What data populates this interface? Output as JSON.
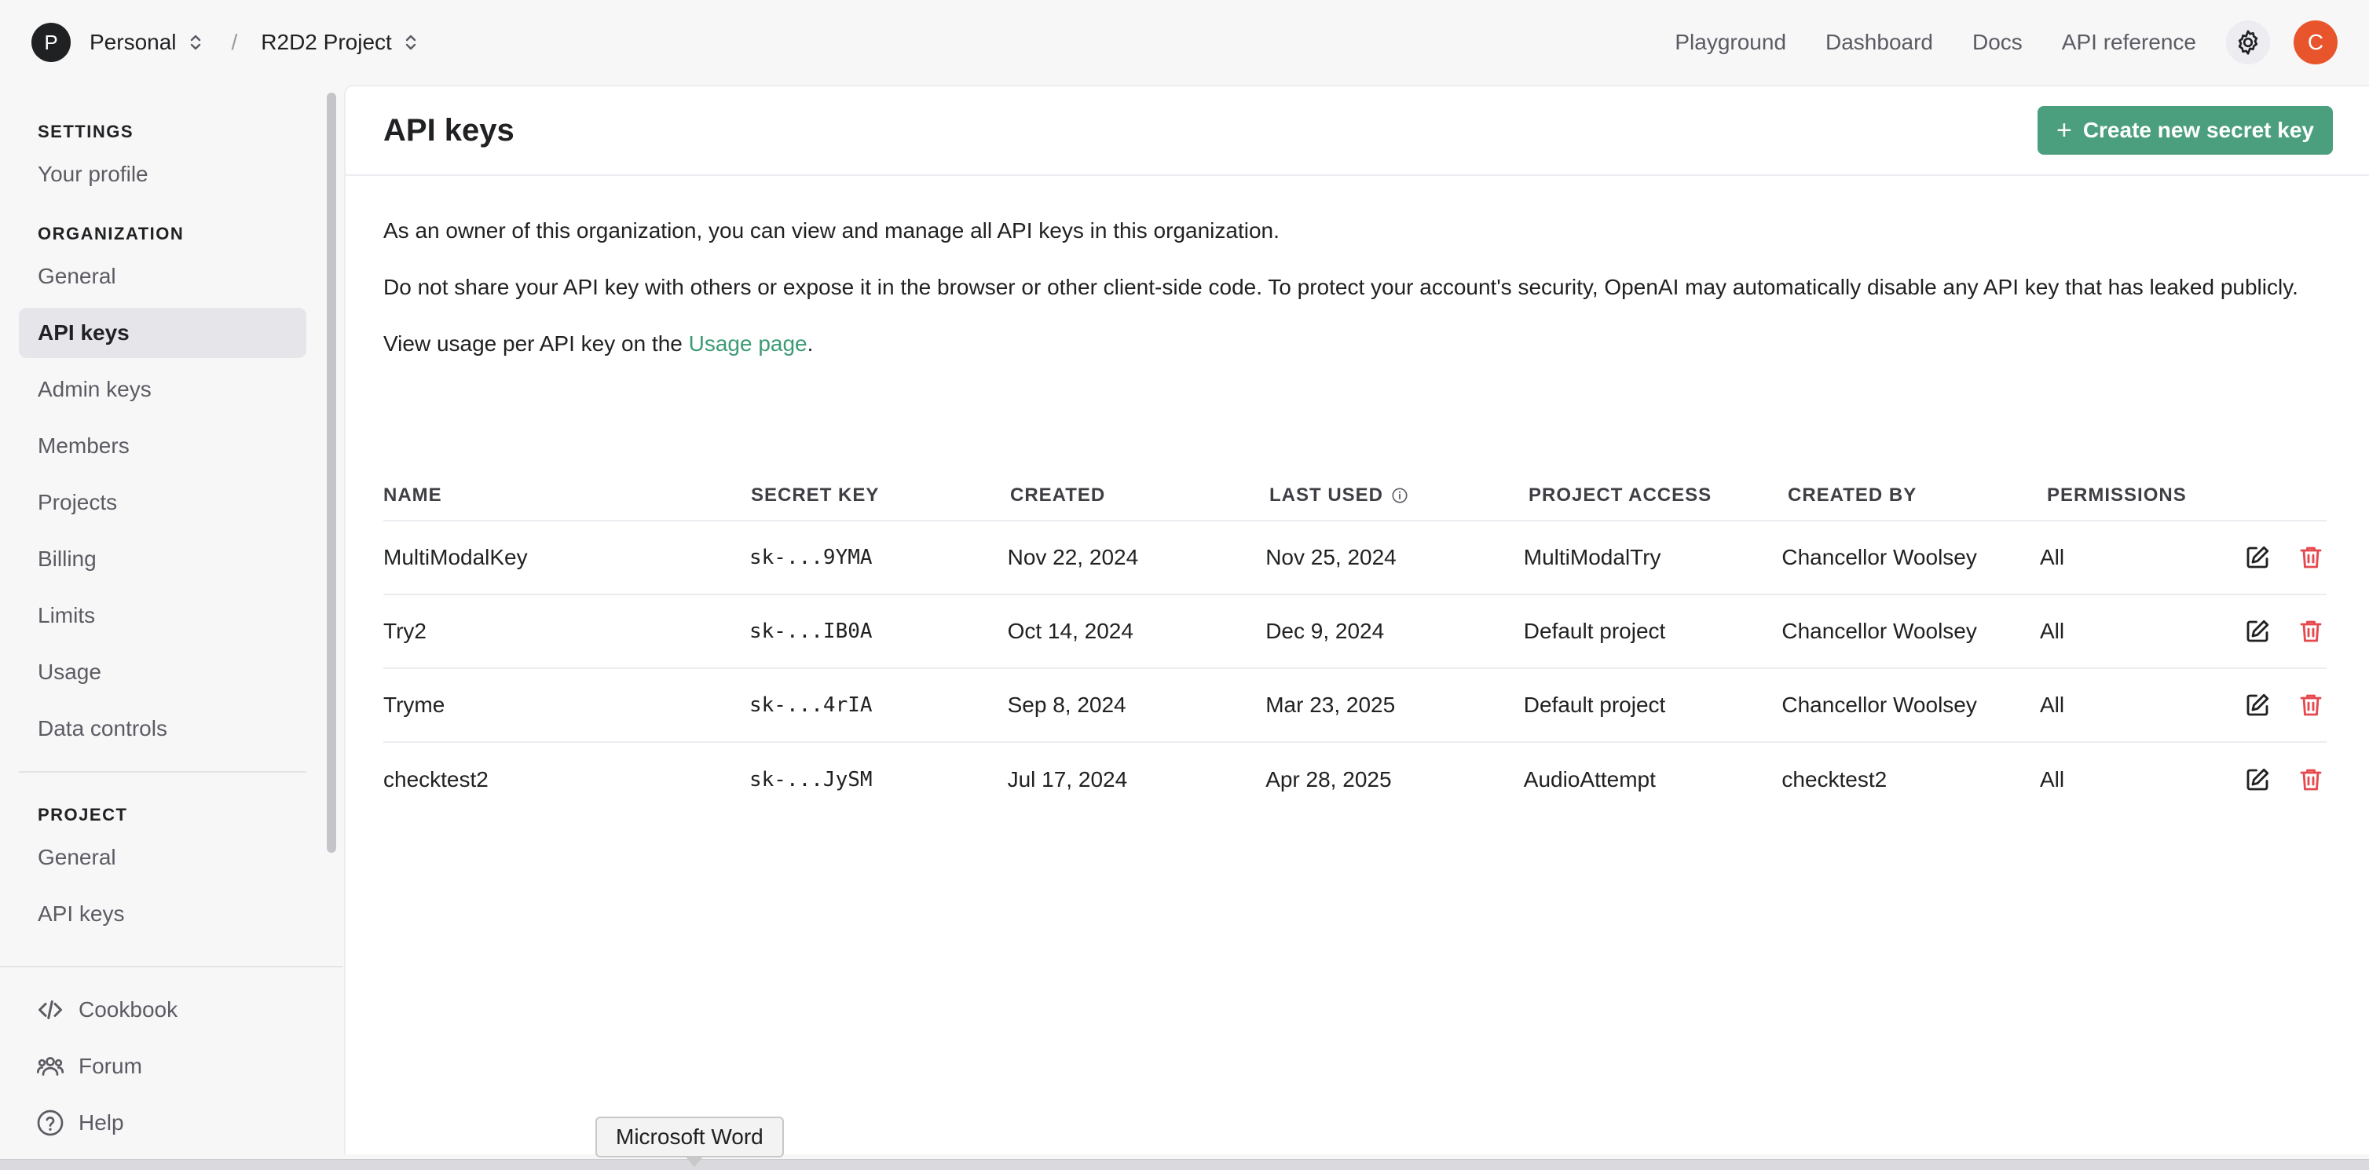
{
  "topbar": {
    "org_initial": "P",
    "org_name": "Personal",
    "separator": "/",
    "project_name": "R2D2 Project",
    "nav": [
      "Playground",
      "Dashboard",
      "Docs",
      "API reference"
    ],
    "user_initial": "C"
  },
  "sidebar": {
    "sections": {
      "settings": "SETTINGS",
      "organization": "ORGANIZATION",
      "project": "PROJECT"
    },
    "settings_items": [
      "Your profile"
    ],
    "organization_items": [
      "General",
      "API keys",
      "Admin keys",
      "Members",
      "Projects",
      "Billing",
      "Limits",
      "Usage",
      "Data controls"
    ],
    "project_items": [
      "General",
      "API keys"
    ],
    "active_item": "API keys",
    "bottom_items": [
      "Cookbook",
      "Forum",
      "Help"
    ]
  },
  "main": {
    "title": "API keys",
    "create_button": "Create new secret key",
    "desc1": "As an owner of this organization, you can view and manage all API keys in this organization.",
    "desc2": "Do not share your API key with others or expose it in the browser or other client-side code. To protect your account's security, OpenAI may automatically disable any API key that has leaked publicly.",
    "desc3_prefix": "View usage per API key on the ",
    "desc3_link": "Usage page",
    "desc3_suffix": "."
  },
  "table": {
    "headers": [
      "NAME",
      "SECRET KEY",
      "CREATED",
      "LAST USED",
      "PROJECT ACCESS",
      "CREATED BY",
      "PERMISSIONS"
    ],
    "rows": [
      [
        "MultiModalKey",
        "sk-...9YMA",
        "Nov 22, 2024",
        "Nov 25, 2024",
        "MultiModalTry",
        "Chancellor Woolsey",
        "All"
      ],
      [
        "Try2",
        "sk-...IB0A",
        "Oct 14, 2024",
        "Dec 9, 2024",
        "Default project",
        "Chancellor Woolsey",
        "All"
      ],
      [
        "Tryme",
        "sk-...4rIA",
        "Sep 8, 2024",
        "Mar 23, 2025",
        "Default project",
        "Chancellor Woolsey",
        "All"
      ],
      [
        "checktest2",
        "sk-...JySM",
        "Jul 17, 2024",
        "Apr 28, 2025",
        "AudioAttempt",
        "checktest2",
        "All"
      ]
    ]
  },
  "tooltip": "Microsoft Word",
  "colors": {
    "accent_green": "#4b9f7e",
    "delete_red": "#e5484d",
    "user_avatar": "#e8552d"
  }
}
